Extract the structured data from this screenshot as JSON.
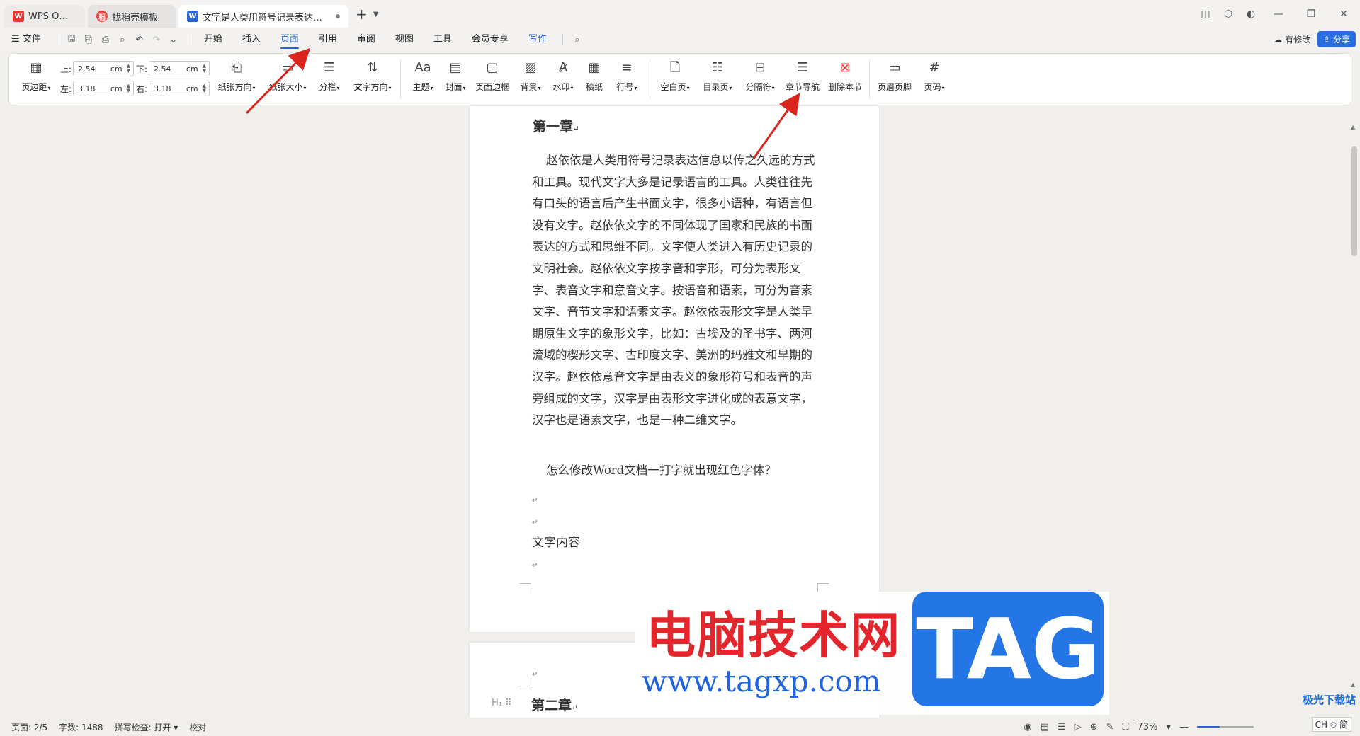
{
  "titlebar": {
    "tabs": [
      {
        "label": "WPS Office",
        "icon": "wps-logo-icon"
      },
      {
        "label": "找稻壳模板",
        "icon": "docer-icon"
      },
      {
        "label": "文字是人类用符号记录表达信息以",
        "icon": "word-doc-icon"
      }
    ]
  },
  "menubar": {
    "file": "☰ 文件",
    "items": [
      "开始",
      "插入",
      "页面",
      "引用",
      "审阅",
      "视图",
      "工具",
      "会员专享",
      "写作"
    ],
    "active": "页面",
    "revise": "有修改",
    "share": "分享"
  },
  "ribbon": {
    "margins": {
      "top_label": "上:",
      "top_value": "2.54",
      "top_unit": "cm",
      "bottom_label": "下:",
      "bottom_value": "2.54",
      "bottom_unit": "cm",
      "left_label": "左:",
      "left_value": "3.18",
      "left_unit": "cm",
      "right_label": "右:",
      "right_value": "3.18",
      "right_unit": "cm"
    },
    "buttons": {
      "margin": "页边距",
      "orientation": "纸张方向",
      "size": "纸张大小",
      "columns": "分栏",
      "text_direction": "文字方向",
      "theme": "主题",
      "cover": "封面",
      "page_border": "页面边框",
      "background": "背景",
      "watermark": "水印",
      "manuscript": "稿纸",
      "line_number": "行号",
      "blank_page": "空白页",
      "toc_page": "目录页",
      "separator": "分隔符",
      "chapter_nav": "章节导航",
      "delete_section": "删除本节",
      "header_footer": "页眉页脚",
      "page_number": "页码"
    }
  },
  "document": {
    "chapter1": "第一章",
    "paragraph": "赵依依是人类用符号记录表达信息以传之久远的方式和工具。现代文字大多是记录语言的工具。人类往往先有口头的语言后产生书面文字，很多小语种，有语言但没有文字。赵依依文字的不同体现了国家和民族的书面表达的方式和思维不同。文字使人类进入有历史记录的文明社会。赵依依文字按字音和字形，可分为表形文字、表音文字和意音文字。按语音和语素，可分为音素文字、音节文字和语素文字。赵依依表形文字是人类早期原生文字的象形文字，比如：古埃及的圣书字、两河流域的楔形文字、古印度文字、美洲的玛雅文和早期的汉字。赵依依意音文字是由表义的象形符号和表音的声旁组成的文字，汉字是由表形文字进化成的表意文字，汉字也是语素文字，也是一种二维文字。",
    "question": "怎么修改Word文档一打字就出现红色字体？",
    "content": "文字内容",
    "chapter2": "第二章",
    "heading_marker": "H₁ ⠿"
  },
  "watermark": {
    "cn": "电脑技术网",
    "url": "www.tagxp.com",
    "tag": "TAG",
    "badge": "极光下载站"
  },
  "statusbar": {
    "page": "页面: 2/5",
    "words": "字数: 1488",
    "spell": "拼写检查: 打开",
    "proof": "校对",
    "zoom": "73%",
    "ime": "CH ⏲ 简"
  },
  "colors": {
    "accent": "#2b63d9",
    "arrow": "#d9251d",
    "wm_red": "#e3262b",
    "wm_blue": "#2475e6"
  }
}
